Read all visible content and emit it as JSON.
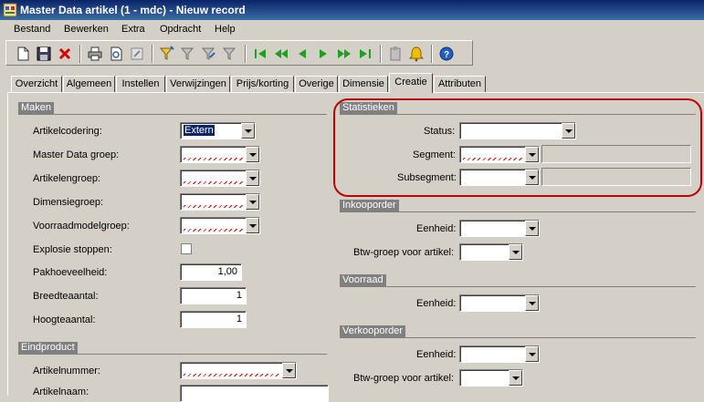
{
  "window": {
    "title": "Master Data artikel (1 - mdc) - Nieuw record"
  },
  "menu": [
    "Bestand",
    "Bewerken",
    "Extra",
    "Opdracht",
    "Help"
  ],
  "toolbar": {
    "icons": [
      "new-icon",
      "save-icon",
      "delete-icon",
      "print-icon",
      "print-preview-icon",
      "properties-icon",
      "filter-icon",
      "filter-selection-icon",
      "advanced-filter-icon",
      "remove-filter-icon",
      "first-record-icon",
      "previous-page-icon",
      "previous-record-icon",
      "next-record-icon",
      "next-page-icon",
      "last-record-icon",
      "attachment-icon",
      "alert-icon",
      "help-icon"
    ]
  },
  "tabs": [
    "Overzicht",
    "Algemeen",
    "Instellen",
    "Verwijzingen",
    "Prijs/korting",
    "Overige",
    "Dimensie",
    "Creatie",
    "Attributen"
  ],
  "active_tab": "Creatie",
  "maken": {
    "header": "Maken",
    "artikelcodering_label": "Artikelcodering:",
    "artikelcodering_value": "Extern",
    "master_data_groep_label": "Master Data groep:",
    "artikelengroep_label": "Artikelengroep:",
    "dimensiegroep_label": "Dimensiegroep:",
    "voorraadmodelgroep_label": "Voorraadmodelgroep:",
    "explosie_label": "Explosie stoppen:",
    "pakhoeveelheid_label": "Pakhoeveelheid:",
    "pakhoeveelheid_value": "1,00",
    "breedteaantal_label": "Breedteaantal:",
    "breedteaantal_value": "1",
    "hoogteaantal_label": "Hoogteaantal:",
    "hoogteaantal_value": "1"
  },
  "eindproduct": {
    "header": "Eindproduct",
    "artikelnummer_label": "Artikelnummer:",
    "artikelnaam_label": "Artikelnaam:"
  },
  "statistieken": {
    "header": "Statistieken",
    "status_label": "Status:",
    "segment_label": "Segment:",
    "subsegment_label": "Subsegment:"
  },
  "inkooporder": {
    "header": "Inkooporder",
    "eenheid_label": "Eenheid:",
    "btw_label": "Btw-groep voor artikel:"
  },
  "voorraad": {
    "header": "Voorraad",
    "eenheid_label": "Eenheid:"
  },
  "verkooporder": {
    "header": "Verkooporder",
    "eenheid_label": "Eenheid:",
    "btw_label": "Btw-groep voor artikel:"
  },
  "colors": {
    "titlebar": "#0a246a",
    "highlight": "#c00000",
    "face": "#d4d0c8"
  }
}
